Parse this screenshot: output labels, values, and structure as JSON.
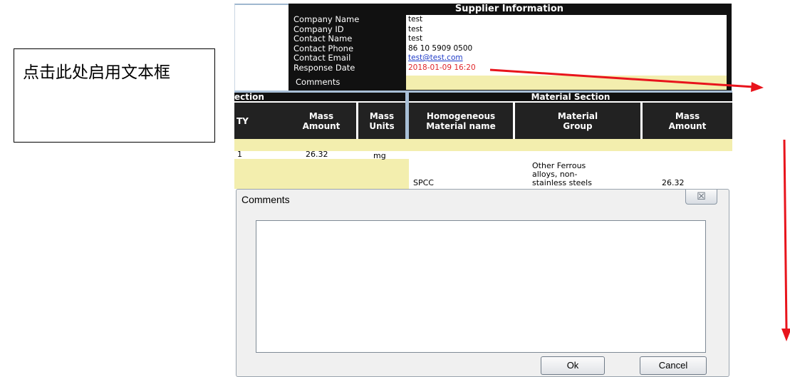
{
  "annotation": {
    "text": "点击此处启用文本框"
  },
  "supplier": {
    "title": "Supplier Information",
    "labels": [
      "Company Name",
      "Company ID",
      "Contact Name",
      "Contact Phone",
      "Contact Email",
      "Response Date"
    ],
    "values": [
      "test",
      "test",
      "test",
      "86 10 5909 0500",
      "test@test.com",
      "2018-01-09 16:20"
    ],
    "comments_label": "Comments"
  },
  "sections": {
    "left": "ection",
    "right": "Material Section"
  },
  "columns": {
    "left": [
      "TY",
      "Mass\nAmount",
      "Mass\nUnits"
    ],
    "right": [
      "Homogeneous\nMaterial name",
      "Material\nGroup",
      "Mass\nAmount"
    ]
  },
  "rows": {
    "left": [
      "1",
      "26.32",
      "mg"
    ],
    "right": [
      "SPCC",
      "Other Ferrous\nalloys, non-\nstainless steels",
      "26.32"
    ]
  },
  "dialog": {
    "title": "Comments",
    "close": "☒",
    "ok": "Ok",
    "cancel": "Cancel",
    "value": ""
  },
  "colors": {
    "arrow": "#e8141c",
    "header": "#111111",
    "highlight": "#f3eeae"
  }
}
